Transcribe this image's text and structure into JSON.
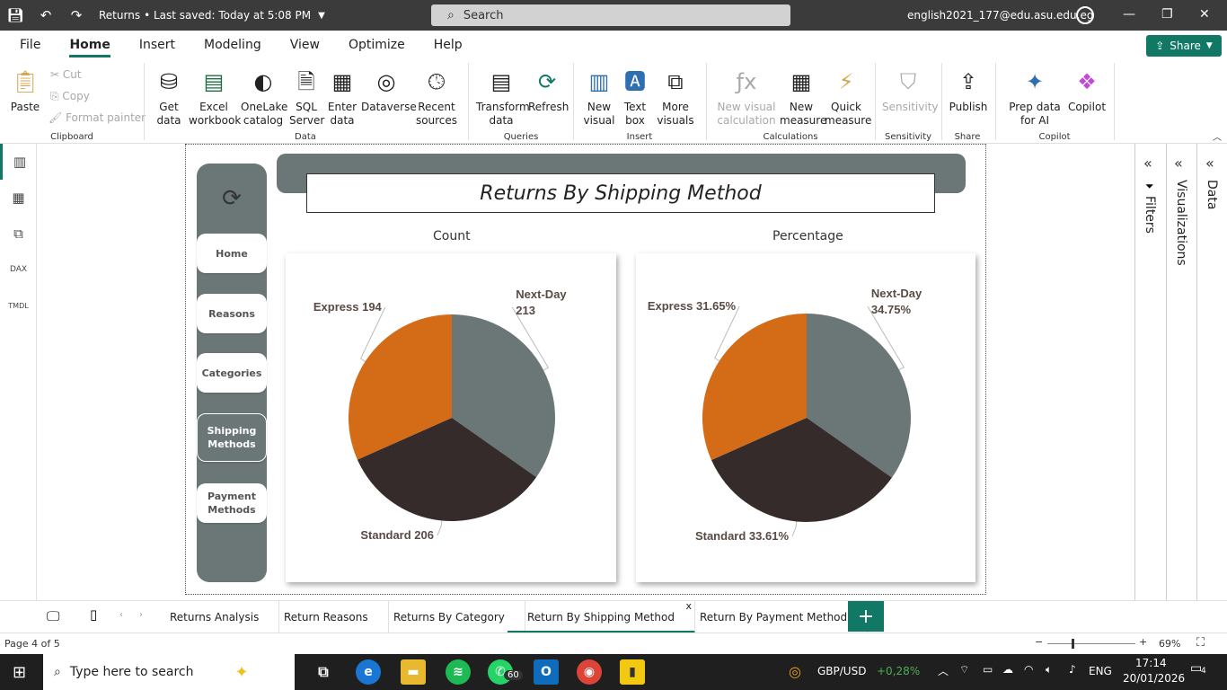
{
  "titlebar": {
    "title": "Returns",
    "saved": "• Last saved: Today at 5:08 PM",
    "search_placeholder": "Search",
    "account": "english2021_177@edu.asu.edu.eg"
  },
  "menu": {
    "items": [
      "File",
      "Home",
      "Insert",
      "Modeling",
      "View",
      "Optimize",
      "Help"
    ],
    "active": "Home",
    "share_label": "Share"
  },
  "ribbon": {
    "clipboard": {
      "paste": "Paste",
      "cut": "Cut",
      "copy": "Copy",
      "format_painter": "Format painter",
      "label": "Clipboard"
    },
    "data": {
      "get_data": "Get data",
      "excel": "Excel workbook",
      "onelake": "OneLake catalog",
      "sql": "SQL Server",
      "enter": "Enter data",
      "dataverse": "Dataverse",
      "recent": "Recent sources",
      "label": "Data"
    },
    "queries": {
      "transform": "Transform data",
      "refresh": "Refresh",
      "label": "Queries"
    },
    "insert": {
      "new_visual": "New visual",
      "text_box": "Text box",
      "more_visuals": "More visuals",
      "label": "Insert"
    },
    "calculations": {
      "new_visual_calc": "New visual calculation",
      "new_measure": "New measure",
      "quick_measure": "Quick measure",
      "label": "Calculations"
    },
    "sensitivity": {
      "sensitivity": "Sensitivity",
      "label": "Sensitivity"
    },
    "share": {
      "publish": "Publish",
      "label": "Share"
    },
    "copilot": {
      "prep": "Prep data for AI",
      "copilot": "Copilot",
      "label": "Copilot"
    }
  },
  "report": {
    "title": "Returns By Shipping Method",
    "nav_buttons": [
      "Home",
      "Reasons",
      "Categories",
      "Shipping Methods",
      "Payment Methods"
    ],
    "active_nav": "Shipping Methods",
    "count_label": "Count",
    "percent_label": "Percentage"
  },
  "chart_data": [
    {
      "type": "pie",
      "title": "Count",
      "categories": [
        "Next-Day",
        "Standard",
        "Express"
      ],
      "values": [
        213,
        206,
        194
      ],
      "data_labels": [
        "Next-Day 213",
        "Standard 206",
        "Express 194"
      ],
      "colors": [
        "#6b7677",
        "#362b2b",
        "#d46b17"
      ]
    },
    {
      "type": "pie",
      "title": "Percentage",
      "categories": [
        "Next-Day",
        "Standard",
        "Express"
      ],
      "values": [
        34.75,
        33.61,
        31.65
      ],
      "data_labels": [
        "Next-Day 34.75%",
        "Standard 33.61%",
        "Express 31.65%"
      ],
      "colors": [
        "#6b7677",
        "#362b2b",
        "#d46b17"
      ]
    }
  ],
  "panes": {
    "filters": "Filters",
    "visualizations": "Visualizations",
    "data": "Data"
  },
  "tabs": {
    "items": [
      "Returns Analysis",
      "Return Reasons",
      "Returns By Category",
      "Return By Shipping Method",
      "Return By Payment Method"
    ],
    "active": "Return By Shipping Method",
    "close": "x",
    "add": "+"
  },
  "status": {
    "page": "Page 4 of 5",
    "zoom": "69%"
  },
  "taskbar": {
    "search_placeholder": "Type here to search",
    "whatsapp_badge": "60",
    "ticker": "GBP/USD",
    "ticker_change": "+0,28%",
    "lang": "ENG",
    "time": "17:14",
    "date": "20/01/2026",
    "notifications": "4"
  },
  "colors": {
    "accent": "#117865",
    "slate": "#6b7677",
    "dark": "#362b2b",
    "orange": "#d46b17"
  }
}
